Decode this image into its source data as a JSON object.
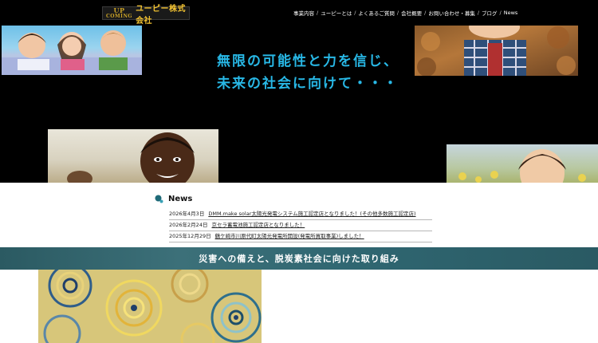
{
  "header": {
    "logo": {
      "mark_top": "UP",
      "mark_bottom": "COMING",
      "text": "ユーピー株式会社"
    },
    "nav": [
      {
        "label": "事業内容"
      },
      {
        "label": "ユーピーとは"
      },
      {
        "label": "よくあるご質問"
      },
      {
        "label": "会社概要"
      },
      {
        "label": "お問い合わせ・募集"
      },
      {
        "label": "ブログ"
      },
      {
        "label": "News"
      }
    ],
    "separator": "/"
  },
  "hero": {
    "line1": "無限の可能性と力を信じ、",
    "line2": "未来の社会に向けて・・・"
  },
  "news": {
    "title": "News",
    "items": [
      {
        "date": "2026年4月3日",
        "text": "DMM.make solar太陽光発電システム施工認定店となりました！(その他多数施工認定店)"
      },
      {
        "date": "2026年2月24日",
        "text": "京セラ蓄電池施工認定店となりました！"
      },
      {
        "date": "2025年12月29日",
        "text": "鶴ケ崎市川原代町太陽光発電所開設(発電所買取事業)しました！"
      }
    ]
  },
  "banner": {
    "text": "災害への備えと、脱炭素社会に向けた取り組み"
  },
  "colors": {
    "accent_cyan": "#28b8e6",
    "logo_gold": "#f2c230",
    "banner_teal": "#2f6671",
    "background": "#000000"
  }
}
